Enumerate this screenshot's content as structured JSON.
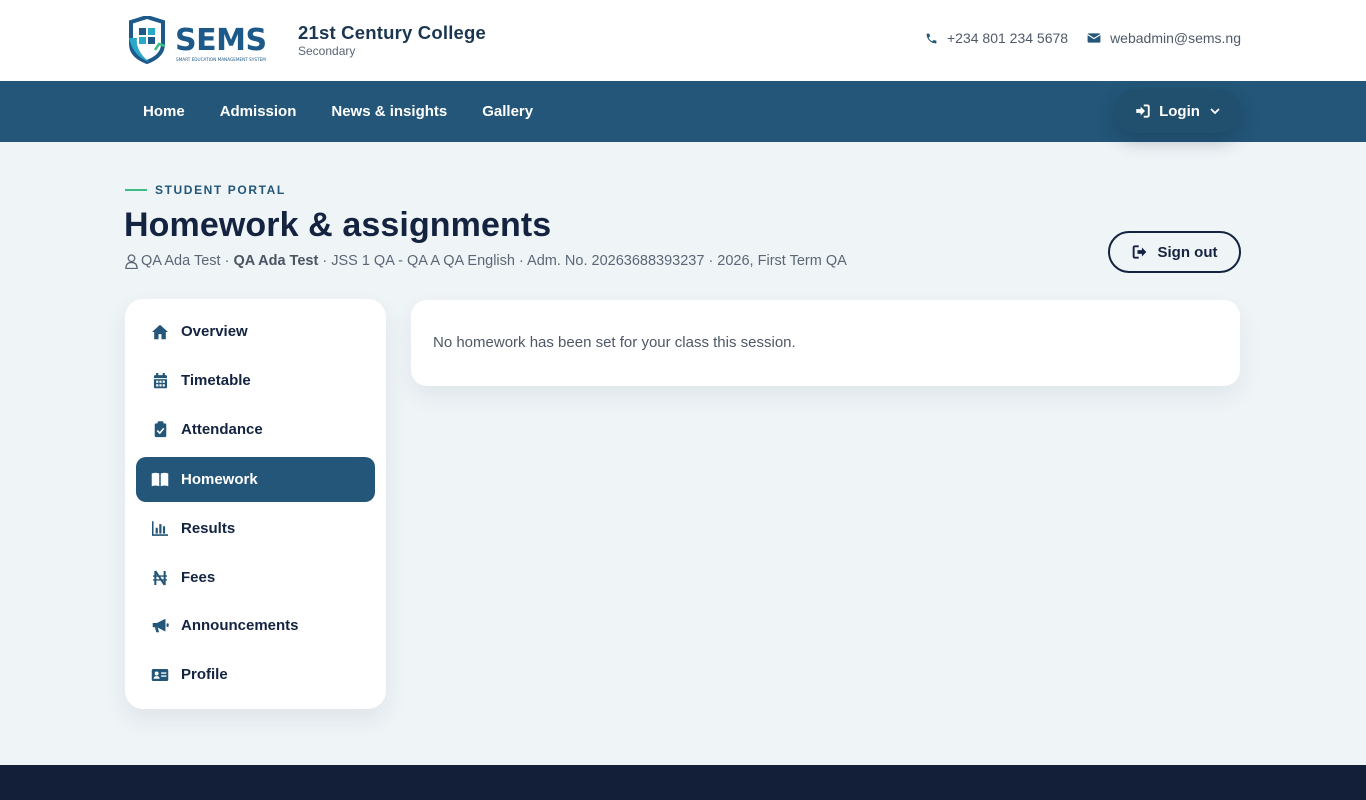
{
  "header": {
    "logo": {
      "wordmark": "SEMS",
      "tagline": "SMART EDUCATION MANAGEMENT SYSTEM"
    },
    "college_name": "21st Century College",
    "college_type": "Secondary",
    "contacts": [
      {
        "icon": "phone-icon",
        "text": "+234 801 234 5678"
      },
      {
        "icon": "envelope-icon",
        "text": "webadmin@sems.ng"
      }
    ]
  },
  "nav": {
    "links": [
      "Home",
      "Admission",
      "News & insights",
      "Gallery"
    ],
    "login_label": "Login"
  },
  "page": {
    "eyebrow": "STUDENT PORTAL",
    "title": "Homework & assignments",
    "meta": {
      "name": "QA Ada Test",
      "sep1": " · ",
      "name_bold": "QA Ada Test",
      "details": " · JSS 1 QA - QA A QA English · Adm. No. 20263688393237 · 2026, First Term QA"
    },
    "signout_label": "Sign out"
  },
  "sidebar": {
    "items": [
      {
        "label": "Overview",
        "icon": "home-icon",
        "active": false
      },
      {
        "label": "Timetable",
        "icon": "calendar-icon",
        "active": false
      },
      {
        "label": "Attendance",
        "icon": "clipboard-check-icon",
        "active": false
      },
      {
        "label": "Homework",
        "icon": "book-open-icon",
        "active": true
      },
      {
        "label": "Results",
        "icon": "chart-icon",
        "active": false
      },
      {
        "label": "Fees",
        "icon": "naira-icon",
        "active": false
      },
      {
        "label": "Announcements",
        "icon": "megaphone-icon",
        "active": false
      },
      {
        "label": "Profile",
        "icon": "id-card-icon",
        "active": false
      }
    ]
  },
  "main": {
    "empty_message": "No homework has been set for your class this session."
  },
  "colors": {
    "primary": "#235678",
    "dark": "#142340",
    "accent_green": "#3dbd86",
    "background": "#eff4f7",
    "footer": "#131f38"
  }
}
